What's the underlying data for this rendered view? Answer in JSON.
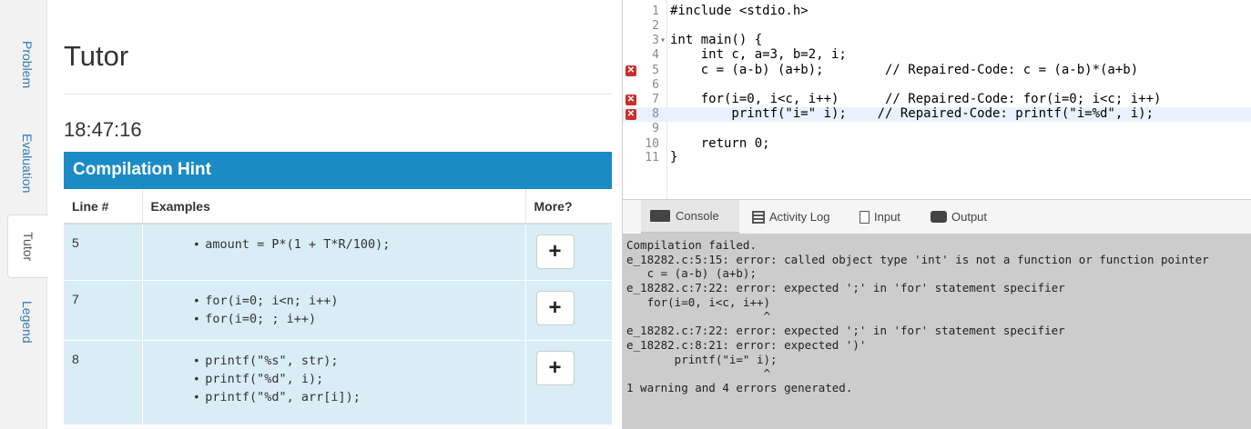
{
  "side_tabs": [
    {
      "label": "Problem",
      "active": false
    },
    {
      "label": "Evaluation",
      "active": false
    },
    {
      "label": "Tutor",
      "active": true
    },
    {
      "label": "Legend",
      "active": false
    }
  ],
  "tutor": {
    "title": "Tutor",
    "timer": "18:47:16",
    "hint_title": "Compilation Hint",
    "columns": [
      "Line #",
      "Examples",
      "More?"
    ],
    "rows": [
      {
        "line": "5",
        "examples": [
          "amount = P*(1 + T*R/100);"
        ],
        "more_label": "+"
      },
      {
        "line": "7",
        "examples": [
          "for(i=0; i<n; i++)",
          "for(i=0; ; i++)"
        ],
        "more_label": "+"
      },
      {
        "line": "8",
        "examples": [
          "printf(\"%s\", str);",
          "printf(\"%d\", i);",
          "printf(\"%d\", arr[i]);"
        ],
        "more_label": "+"
      }
    ]
  },
  "editor": {
    "lines": [
      {
        "num": "1",
        "text": "#include <stdio.h>",
        "error": false,
        "active": false
      },
      {
        "num": "2",
        "text": "",
        "error": false,
        "active": false
      },
      {
        "num": "3",
        "text": "int main() {",
        "error": false,
        "active": false,
        "fold": "▾"
      },
      {
        "num": "4",
        "text": "    int c, a=3, b=2, i;",
        "error": false,
        "active": false
      },
      {
        "num": "5",
        "text": "    c = (a-b) (a+b);        // Repaired-Code: c = (a-b)*(a+b)",
        "error": true,
        "active": false
      },
      {
        "num": "6",
        "text": "",
        "error": false,
        "active": false
      },
      {
        "num": "7",
        "text": "    for(i=0, i<c, i++)      // Repaired-Code: for(i=0; i<c; i++)",
        "error": true,
        "active": false
      },
      {
        "num": "8",
        "text": "        printf(\"i=\" i);    // Repaired-Code: printf(\"i=%d\", i);",
        "error": true,
        "active": true
      },
      {
        "num": "9",
        "text": "",
        "error": false,
        "active": false
      },
      {
        "num": "10",
        "text": "    return 0;",
        "error": false,
        "active": false
      },
      {
        "num": "11",
        "text": "}",
        "error": false,
        "active": false
      }
    ],
    "error_marker": "✕"
  },
  "console_tabs": [
    {
      "label": "Console",
      "icon": "monitor-icon",
      "active": true
    },
    {
      "label": "Activity Log",
      "icon": "list-icon",
      "active": false
    },
    {
      "label": "Input",
      "icon": "file-icon",
      "active": false
    },
    {
      "label": "Output",
      "icon": "printer-icon",
      "active": false
    }
  ],
  "console_output": [
    "Compilation failed.",
    "e_18282.c:5:15: error: called object type 'int' is not a function or function pointer",
    "   c = (a-b) (a+b);",
    "e_18282.c:7:22: error: expected ';' in 'for' statement specifier",
    "   for(i=0, i<c, i++)",
    "                    ^",
    "e_18282.c:7:22: error: expected ';' in 'for' statement specifier",
    "e_18282.c:8:21: error: expected ')'",
    "       printf(\"i=\" i);",
    "                    ^",
    "1 warning and 4 errors generated."
  ],
  "colors": {
    "hint_header": "#1b8bc6",
    "hint_row": "#d9edf7",
    "link": "#337ab7",
    "error_marker": "#c9302c",
    "console_bg": "#cccccc"
  }
}
